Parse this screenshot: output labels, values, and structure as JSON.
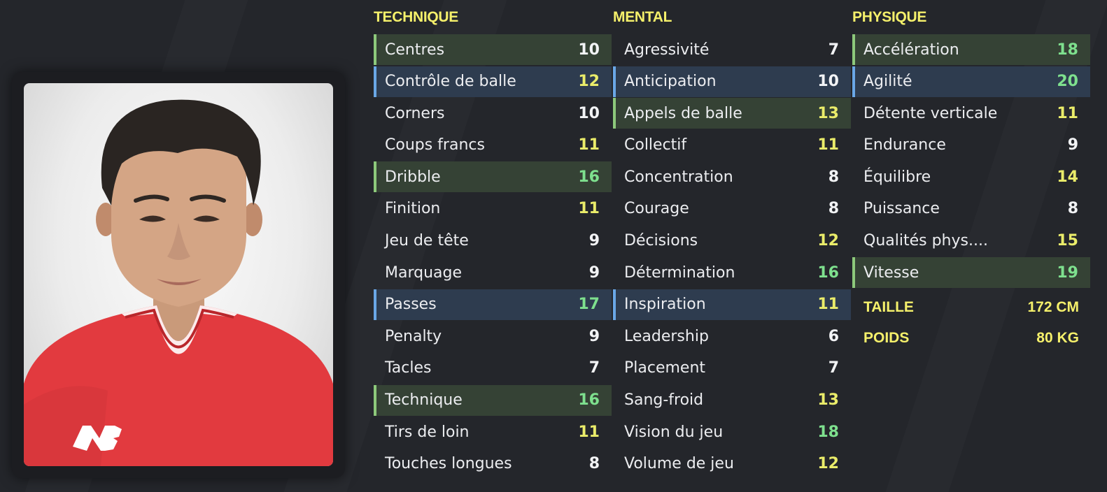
{
  "technique": {
    "title": "TECHNIQUE",
    "rows": [
      {
        "name": "Centres",
        "value": "10",
        "hl": "green",
        "tone": "white"
      },
      {
        "name": "Contrôle de balle",
        "value": "12",
        "hl": "blue",
        "tone": "yellow"
      },
      {
        "name": "Corners",
        "value": "10",
        "hl": "",
        "tone": "white"
      },
      {
        "name": "Coups francs",
        "value": "11",
        "hl": "",
        "tone": "yellow"
      },
      {
        "name": "Dribble",
        "value": "16",
        "hl": "green",
        "tone": "green"
      },
      {
        "name": "Finition",
        "value": "11",
        "hl": "",
        "tone": "yellow"
      },
      {
        "name": "Jeu de tête",
        "value": "9",
        "hl": "",
        "tone": "white"
      },
      {
        "name": "Marquage",
        "value": "9",
        "hl": "",
        "tone": "white"
      },
      {
        "name": "Passes",
        "value": "17",
        "hl": "blue",
        "tone": "green"
      },
      {
        "name": "Penalty",
        "value": "9",
        "hl": "",
        "tone": "white"
      },
      {
        "name": "Tacles",
        "value": "7",
        "hl": "",
        "tone": "white"
      },
      {
        "name": "Technique",
        "value": "16",
        "hl": "green",
        "tone": "green"
      },
      {
        "name": "Tirs de loin",
        "value": "11",
        "hl": "",
        "tone": "yellow"
      },
      {
        "name": "Touches longues",
        "value": "8",
        "hl": "",
        "tone": "white"
      }
    ]
  },
  "mental": {
    "title": "MENTAL",
    "rows": [
      {
        "name": "Agressivité",
        "value": "7",
        "hl": "",
        "tone": "white"
      },
      {
        "name": "Anticipation",
        "value": "10",
        "hl": "blue",
        "tone": "white"
      },
      {
        "name": "Appels de balle",
        "value": "13",
        "hl": "green",
        "tone": "yellow"
      },
      {
        "name": "Collectif",
        "value": "11",
        "hl": "",
        "tone": "yellow"
      },
      {
        "name": "Concentration",
        "value": "8",
        "hl": "",
        "tone": "white"
      },
      {
        "name": "Courage",
        "value": "8",
        "hl": "",
        "tone": "white"
      },
      {
        "name": "Décisions",
        "value": "12",
        "hl": "",
        "tone": "yellow"
      },
      {
        "name": "Détermination",
        "value": "16",
        "hl": "",
        "tone": "green"
      },
      {
        "name": "Inspiration",
        "value": "11",
        "hl": "blue",
        "tone": "yellow"
      },
      {
        "name": "Leadership",
        "value": "6",
        "hl": "",
        "tone": "white"
      },
      {
        "name": "Placement",
        "value": "7",
        "hl": "",
        "tone": "white"
      },
      {
        "name": "Sang-froid",
        "value": "13",
        "hl": "",
        "tone": "yellow"
      },
      {
        "name": "Vision du jeu",
        "value": "18",
        "hl": "",
        "tone": "green"
      },
      {
        "name": "Volume de jeu",
        "value": "12",
        "hl": "",
        "tone": "yellow"
      }
    ]
  },
  "physique": {
    "title": "PHYSIQUE",
    "rows": [
      {
        "name": "Accélération",
        "value": "18",
        "hl": "green",
        "tone": "green"
      },
      {
        "name": "Agilité",
        "value": "20",
        "hl": "blue",
        "tone": "green"
      },
      {
        "name": "Détente verticale",
        "value": "11",
        "hl": "",
        "tone": "yellow"
      },
      {
        "name": "Endurance",
        "value": "9",
        "hl": "",
        "tone": "white"
      },
      {
        "name": "Équilibre",
        "value": "14",
        "hl": "",
        "tone": "yellow"
      },
      {
        "name": "Puissance",
        "value": "8",
        "hl": "",
        "tone": "white"
      },
      {
        "name": "Qualités phys....",
        "value": "15",
        "hl": "",
        "tone": "yellow"
      },
      {
        "name": "Vitesse",
        "value": "19",
        "hl": "green",
        "tone": "green"
      }
    ]
  },
  "info": {
    "height_label": "TAILLE",
    "height_value": "172 CM",
    "weight_label": "POIDS",
    "weight_value": "80 KG"
  },
  "portrait": {
    "icon": "player-portrait-icon",
    "kit_color": "#e23a3f",
    "brand_logo": "NB"
  },
  "colors": {
    "title": "#f5f06b",
    "green_hl": "#8dc97b",
    "blue_hl": "#6aa7e6",
    "val_green": "#7ee08e",
    "val_yellow": "#eaec6a"
  }
}
